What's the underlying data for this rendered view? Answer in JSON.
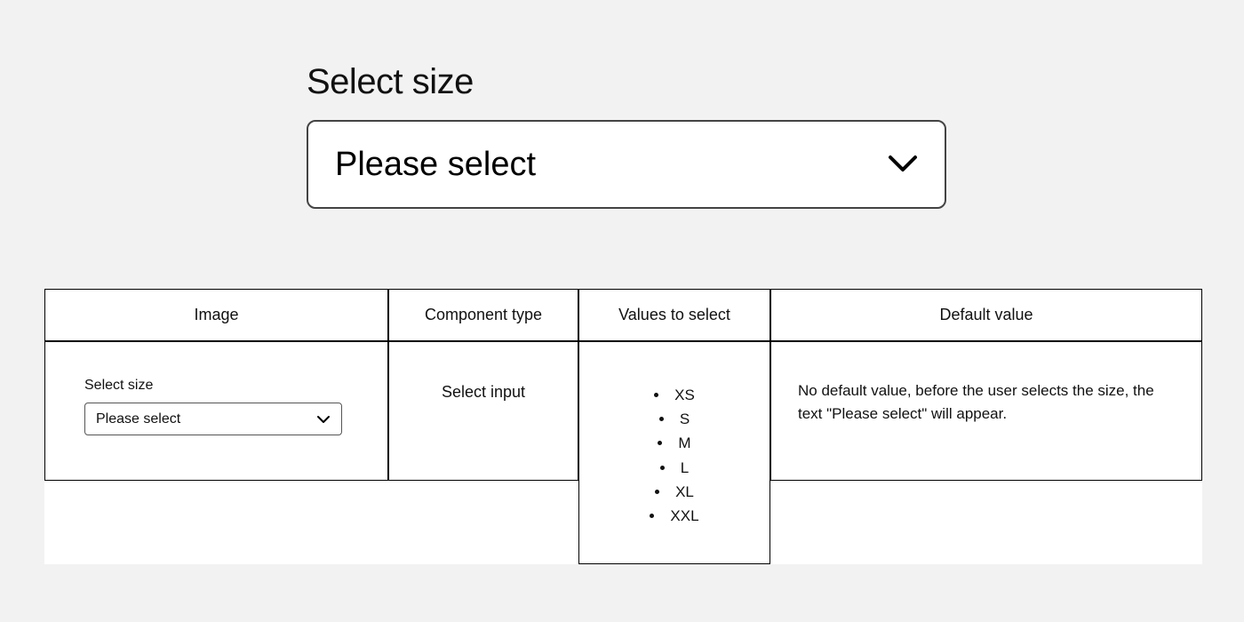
{
  "hero": {
    "label": "Select size",
    "placeholder": "Please select"
  },
  "table": {
    "headers": {
      "image": "Image",
      "component_type": "Component type",
      "values_to_select": "Values to select",
      "default_value": "Default value"
    },
    "row": {
      "image": {
        "label": "Select size",
        "placeholder": "Please select"
      },
      "component_type": "Select input",
      "values": [
        "XS",
        "S",
        "M",
        "L",
        "XL",
        "XXL"
      ],
      "default_value": "No default value, before the user selects the size, the text \"Please select\" will appear."
    }
  }
}
